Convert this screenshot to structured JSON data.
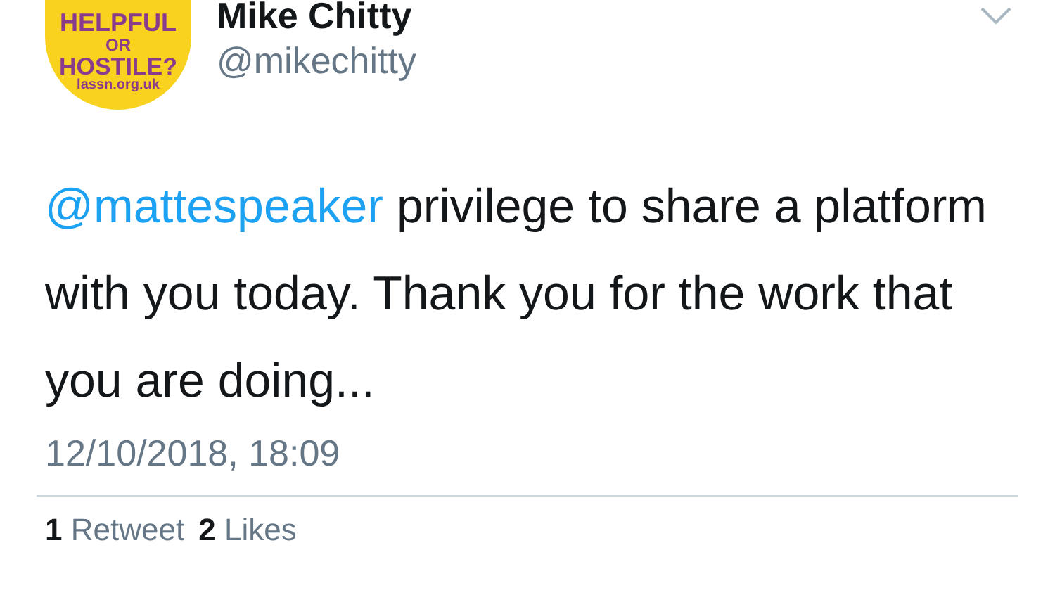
{
  "author": {
    "name": "Mike Chitty",
    "handle": "@mikechitty",
    "avatar": {
      "lines": [
        "HELPFUL",
        "OR",
        "HOSTILE?",
        "lassn.org.uk"
      ]
    }
  },
  "tweet": {
    "mention": "@mattespeaker",
    "text": " privilege to share a platform with you today. Thank you for the work that you are doing...",
    "timestamp": "12/10/2018, 18:09"
  },
  "stats": [
    {
      "count": "1",
      "label": "Retweet"
    },
    {
      "count": "2",
      "label": "Likes"
    }
  ]
}
